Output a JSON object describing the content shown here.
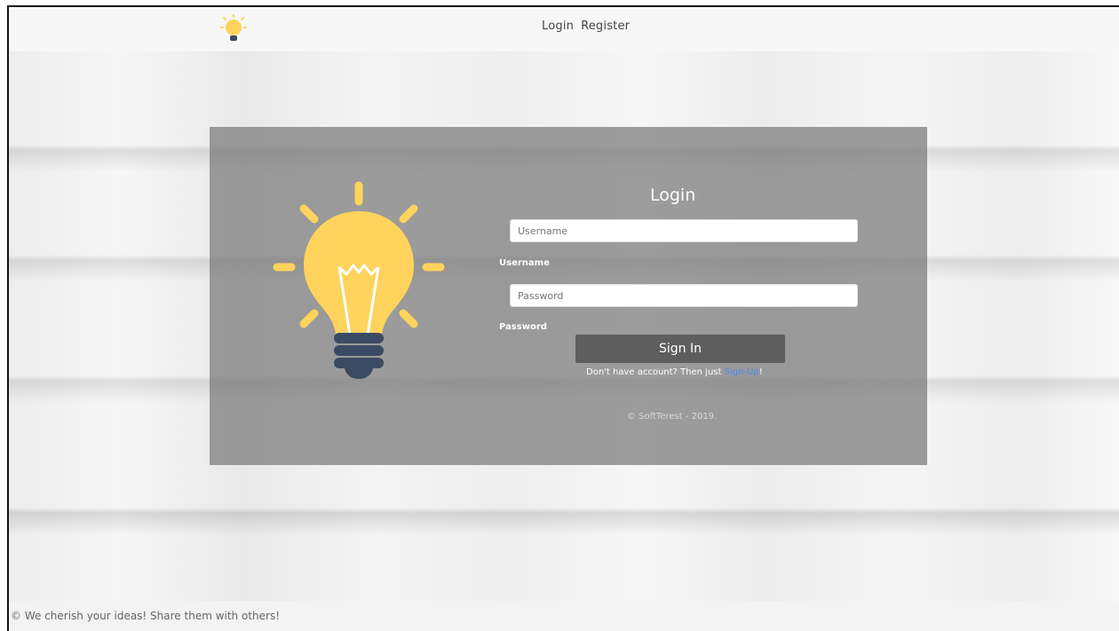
{
  "nav": {
    "logo_icon": "lightbulb-icon",
    "links": [
      "Login",
      "Register"
    ]
  },
  "login": {
    "title": "Login",
    "username_placeholder": "Username",
    "username_label": "Username",
    "password_placeholder": "Password",
    "password_label": "Password",
    "signin_label": "Sign In",
    "signup_prefix": "Don't have account? Then just ",
    "signup_link": "Sign-Up",
    "signup_suffix": "!",
    "copyright": "© SoftTerest - 2019."
  },
  "footer": {
    "text": "© We cherish your ideas! Share them with others!"
  },
  "colors": {
    "bulb_yellow": "#FFD35C",
    "bulb_base": "#3B4A63",
    "link": "#4C8BF5"
  }
}
